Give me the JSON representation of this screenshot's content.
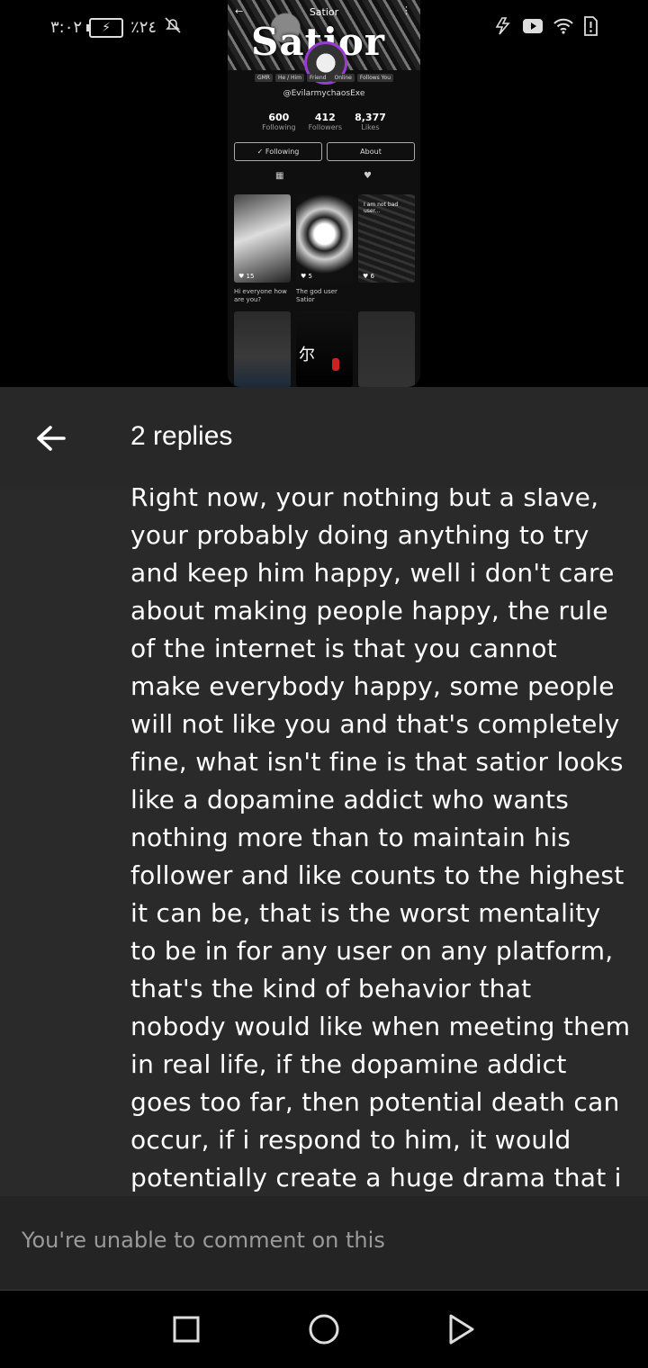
{
  "status_bar": {
    "time": "٣:٠٢",
    "battery_percent": "٪٢٤",
    "icons": [
      "silent-bell-icon",
      "charging-battery-icon",
      "flash-icon",
      "youtube-icon",
      "wifi-icon",
      "alert-sim-icon"
    ]
  },
  "preview": {
    "top_title": "Satior",
    "banner_title": "Satior",
    "badges": [
      "GMR",
      "He / Him",
      "Friend",
      "Online",
      "Follows You"
    ],
    "handle": "@EvilarmychaosExe",
    "stats": [
      {
        "value": "600",
        "label": "Following"
      },
      {
        "value": "412",
        "label": "Followers"
      },
      {
        "value": "8,377",
        "label": "Likes"
      }
    ],
    "following_button": "✓ Following",
    "about_button": "About",
    "posts": [
      {
        "count": "♥ 15",
        "caption": "Hi everyone how are you?"
      },
      {
        "count": "♥ 5",
        "caption": "The god user Satior"
      },
      {
        "count": "♥ 6",
        "caption": "",
        "overlay": "I am not bad user..."
      }
    ],
    "grid_char": "尔"
  },
  "header": {
    "title": "2 replies"
  },
  "reply": {
    "text": "Right now, your nothing but a slave, your probably doing anything to try and keep him happy, well i don't care about making people happy, the rule of the internet is that you cannot make everybody happy, some people will not like you and that's completely fine, what isn't fine is that satior looks like a dopamine addict who wants nothing more than to maintain his follower and like counts to the highest it can be, that is the worst mentality to be in for any user on any platform, that's the kind of behavior that nobody would like when meeting them in real life, if the dopamine addict goes too far, then potential death can occur, if i respond to him, it would potentially create a huge drama that i do not want to be a"
  },
  "footer": {
    "message": "You're unable to comment on this"
  },
  "nav": [
    "recents-square-icon",
    "home-circle-icon",
    "back-triangle-icon"
  ]
}
